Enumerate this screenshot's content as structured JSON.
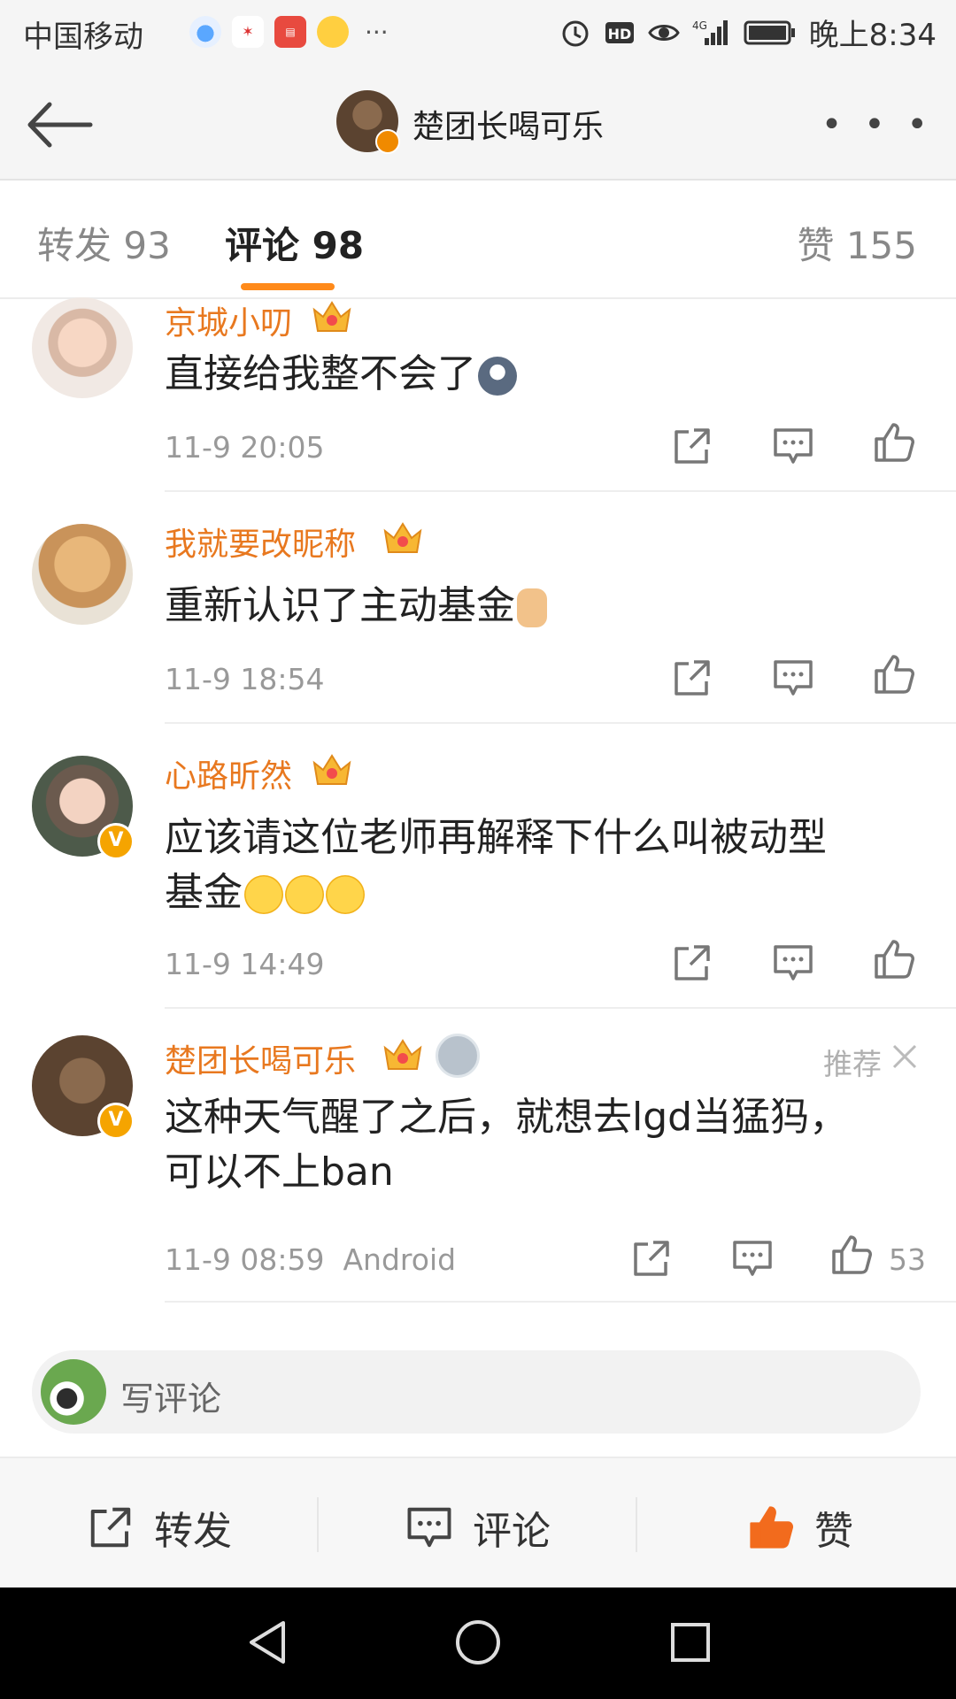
{
  "status_bar": {
    "carrier": "中国移动",
    "app_icons": [
      "qq-browser-icon",
      "sina-icon",
      "pingan-securities-icon",
      "weibo-icon"
    ],
    "more": "···",
    "status_icons": [
      "alarm-icon",
      "hd-icon",
      "eye-icon",
      "signal-4g-icon",
      "battery-icon"
    ],
    "time": "晚上8:34"
  },
  "nav": {
    "title": "楚团长喝可乐",
    "more": "• • •"
  },
  "tabs": {
    "repost": "转发 93",
    "comments": "评论 98",
    "likes": "赞 155",
    "active": "comments",
    "accent": "#ff8a1a"
  },
  "comments": [
    {
      "username": "京城小叨",
      "text": "直接给我整不会了",
      "emoji": [
        "husky-emoji"
      ],
      "time": "11-9 20:05",
      "verified": false
    },
    {
      "username": "我就要改昵称",
      "text": "重新认识了主动基金",
      "emoji": [
        "thumbs-up-emoji"
      ],
      "time": "11-9 18:54",
      "verified": false
    },
    {
      "username": "心路昕然",
      "text_line1": "应该请这位老师再解释下什么叫被动型",
      "text_line2": "基金",
      "emoji": [
        "thinking-emoji",
        "thinking-emoji",
        "thinking-emoji"
      ],
      "time": "11-9 14:49",
      "verified": true
    },
    {
      "username": "楚团长喝可乐",
      "text_line1": "这种天气醒了之后，就想去lgd当猛犸，",
      "text_line2": "可以不上ban",
      "time": "11-9 08:59",
      "source": "Android",
      "like_count": "53",
      "recommend_label": "推荐",
      "verified": true
    }
  ],
  "comment_input": {
    "placeholder": "写评论"
  },
  "action_bar": {
    "repost": "转发",
    "comment": "评论",
    "like": "赞",
    "like_color": "#f26b1d"
  },
  "colors": {
    "username": "#e8781f",
    "meta": "#999999"
  }
}
